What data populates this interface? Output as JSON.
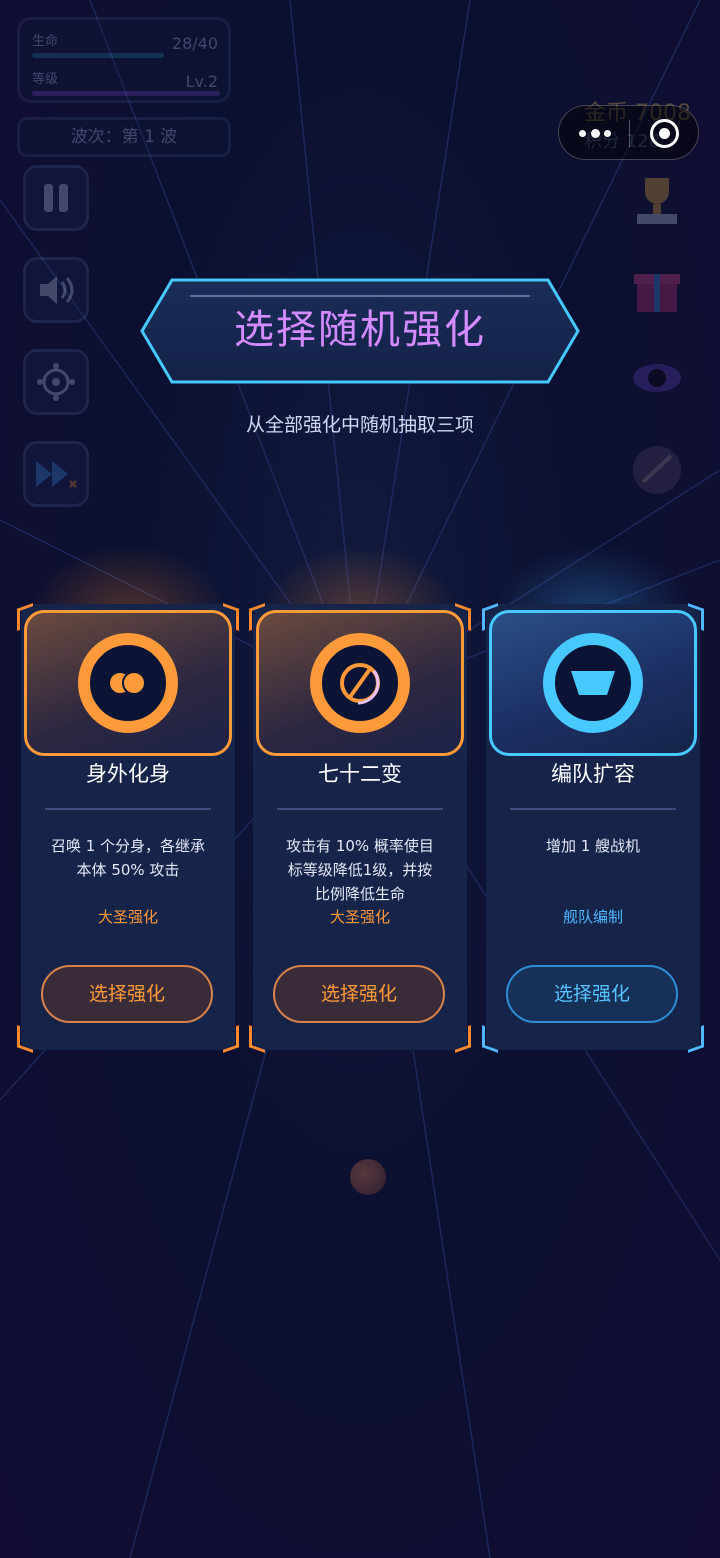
{
  "hud": {
    "life_label": "生命",
    "life_value": "28/40",
    "life_fraction": 0.7,
    "level_label": "等级",
    "level_value": "Lv.2",
    "wave_text": "波次：第 1 波",
    "gold_text": "金币 7008",
    "score_text": "积分 128"
  },
  "modal": {
    "title": "选择随机强化",
    "subtitle": "从全部强化中随机抽取三项"
  },
  "cards": [
    {
      "name": "身外化身",
      "desc": "召唤 1 个分身，各继承本体 50% 攻击",
      "tag": "大圣强化",
      "button": "选择强化",
      "icon": "clone-icon",
      "theme": "#ff9a3a"
    },
    {
      "name": "七十二变",
      "desc": "攻击有 10% 概率使目标等级降低1级，并按比例降低生命",
      "tag": "大圣强化",
      "button": "选择强化",
      "icon": "transform-icon",
      "theme": "#ff9a3a"
    },
    {
      "name": "编队扩容",
      "desc": "增加 1 艘战机",
      "tag": "舰队编制",
      "button": "选择强化",
      "icon": "fleet-icon",
      "theme": "#47c8ff"
    }
  ]
}
